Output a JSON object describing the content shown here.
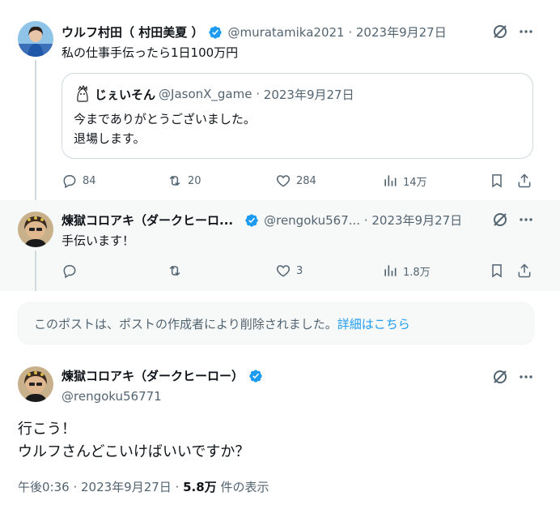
{
  "tweet1": {
    "display_name": "ウルフ村田（ 村田美夏 ）",
    "handle": "@muratamika2021",
    "date": "2023年9月27日",
    "text": "私の仕事手伝ったら1日100万円",
    "quote": {
      "display_name": "じぇいそん",
      "handle": "@JasonX_game",
      "date": "2023年9月27日",
      "line1": "今までありがとうございました。",
      "line2": "退場します。"
    },
    "stats": {
      "replies": "84",
      "reposts": "20",
      "likes": "284",
      "views": "14万"
    }
  },
  "tweet2": {
    "display_name": "煉獄コロアキ（ダークヒーロ...",
    "handle": "@rengoku567...",
    "date": "2023年9月27日",
    "text": "手伝います！",
    "stats": {
      "replies": "",
      "reposts": "",
      "likes": "3",
      "views": "1.8万"
    }
  },
  "deleted_notice": {
    "text": "このポストは、ポストの作成者により削除されました。",
    "link": "詳細はこちら"
  },
  "main_tweet": {
    "display_name": "煉獄コロアキ（ダークヒーロー）",
    "handle": "@rengoku56771",
    "line1": "行こう！",
    "line2": "ウルフさんどこいけばいいですか？",
    "time": "午後0:36 · 2023年9月27日 · ",
    "views_count": "5.8万",
    "views_label": " 件の表示"
  },
  "colors": {
    "accent": "#1d9bf0",
    "muted": "#536471",
    "border": "#cfd9de"
  },
  "icons": [
    "grok-icon",
    "more-icon",
    "reply-icon",
    "repost-icon",
    "like-icon",
    "views-icon",
    "bookmark-icon",
    "share-icon",
    "verified-badge-icon"
  ]
}
